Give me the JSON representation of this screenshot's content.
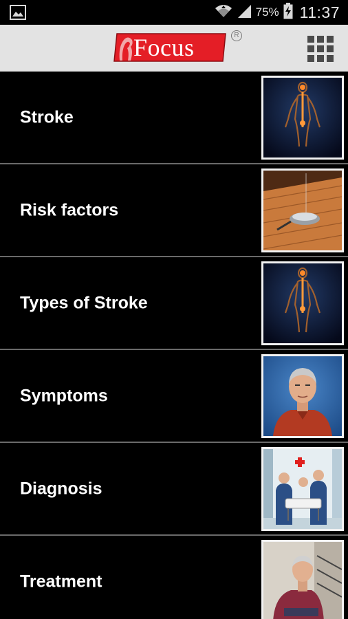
{
  "status_bar": {
    "battery_percent": "75%",
    "time": "11:37",
    "icons": [
      "image-notification-icon",
      "wifi-icon",
      "signal-icon",
      "battery-charging-icon"
    ]
  },
  "app_bar": {
    "logo_text": "Focus",
    "registered_mark": "R",
    "menu_icon": "grid-menu-icon",
    "brand_color": "#e41e26"
  },
  "list": {
    "items": [
      {
        "label": "Stroke",
        "thumbnail": "human-body-nervous-system"
      },
      {
        "label": "Risk factors",
        "thumbnail": "ashtray-cigarette-on-wood-table"
      },
      {
        "label": "Types of Stroke",
        "thumbnail": "human-body-nervous-system"
      },
      {
        "label": "Symptoms",
        "thumbnail": "elderly-man-portrait"
      },
      {
        "label": "Diagnosis",
        "thumbnail": "doctors-hospital-stretcher"
      },
      {
        "label": "Treatment",
        "thumbnail": "elderly-man-seated"
      }
    ]
  }
}
